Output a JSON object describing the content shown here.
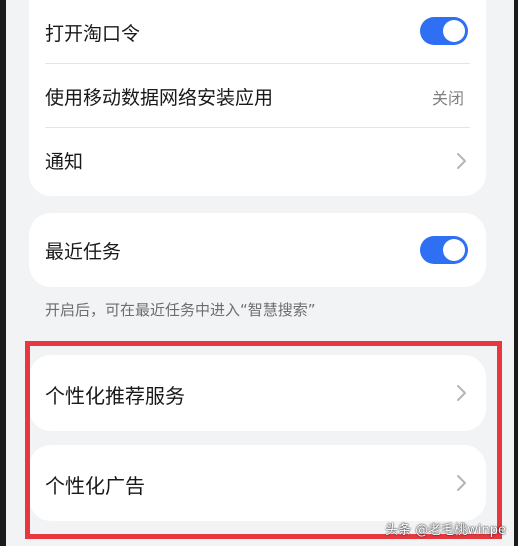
{
  "settings_group_1": {
    "items": [
      {
        "label": "打开淘口令",
        "control": "toggle",
        "state": "on"
      },
      {
        "label": "使用移动数据网络安装应用",
        "value": "关闭"
      },
      {
        "label": "通知",
        "control": "chevron-right-icon"
      }
    ]
  },
  "settings_group_2": {
    "item": {
      "label": "最近任务",
      "control": "toggle",
      "state": "on"
    },
    "hint": "开启后，可在最近任务中进入“智慧搜索”"
  },
  "highlighted_section": {
    "annotation_color": "#e8383f",
    "items": [
      {
        "label": "个性化推荐服务",
        "control": "chevron-right-icon"
      },
      {
        "label": "个性化广告",
        "control": "chevron-right-icon"
      }
    ]
  },
  "watermark": "头条 @老毛桃winpe",
  "colors": {
    "accent": "#2f6ff3",
    "background": "#f1f3f5",
    "card": "#ffffff",
    "annotation": "#e8383f"
  }
}
